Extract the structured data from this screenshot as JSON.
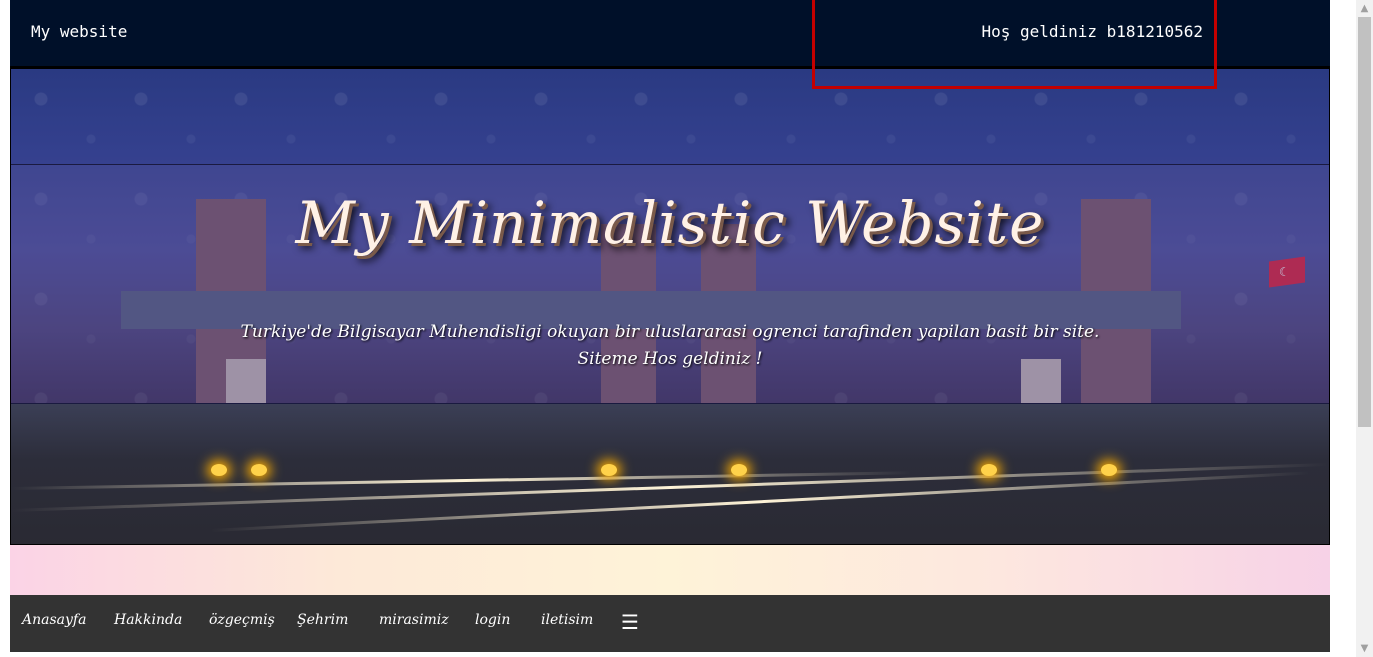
{
  "topbar": {
    "brand": "My website",
    "welcome": "Hoş geldiniz b181210562"
  },
  "hero": {
    "title": "My Minimalistic Website",
    "subtitle_line1": "Turkiye'de Bilgisayar Muhendisligi okuyan bir uluslararasi ogrenci tarafinden yapilan basit bir site.",
    "subtitle_line2": "Siteme Hos geldiniz !"
  },
  "nav": {
    "items": [
      "Anasayfa",
      "Hakkinda",
      "özgeçmiş",
      "Şehrim",
      "mirasimiz",
      "login",
      "iletisim"
    ],
    "menu_icon": "☰"
  },
  "colors": {
    "topbar_bg": "#001029",
    "nav_bg": "#333333",
    "highlight": "#c40000"
  },
  "icons": [
    "menu-icon",
    "scroll-up-icon",
    "scroll-down-icon"
  ]
}
